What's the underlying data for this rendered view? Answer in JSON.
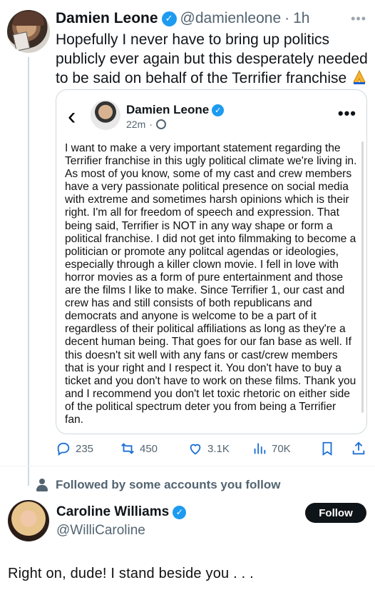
{
  "tweet": {
    "author_name": "Damien Leone",
    "handle": "@damienleone",
    "time": "1h",
    "text": "Hopefully I never have to bring up politics publicly ever again but this desperately needed to be said on behalf of the Terrifier franchise",
    "emoji": "folded-hands-icon"
  },
  "embedded": {
    "author_name": "Damien Leone",
    "time": "22m",
    "body": "I want to make a very important statement regarding the Terrifier franchise in this ugly political climate we're living in. As most of you know, some of my cast and crew members have a very passionate political presence on social media with extreme and sometimes harsh opinions which is their right. I'm all for freedom of speech and expression. That being said, Terrifier is NOT in any way shape or form a political franchise. I did not get into filmmaking to become a politician or promote any politcal agendas or ideologies, especially through a killer clown movie. I fell in love with horror movies as a form of pure entertainment and those are the films I like to make. Since Terrifier 1, our cast and crew has and still consists of both republicans and democrats and anyone is welcome to be a part of it regardless of their political affiliations as long as they're a decent human being. That goes for our fan base as well. If this doesn't sit well with any fans or cast/crew members that is your right and I respect it. You don't have to buy a ticket and you don't have to work on these films. Thank you and I recommend you don't let toxic rhetoric on either side of the political spectrum deter you from being a Terrifier fan."
  },
  "actions": {
    "replies": "235",
    "reposts": "450",
    "likes": "3.1K",
    "views": "70K"
  },
  "followed_by": "Followed by some accounts you follow",
  "suggested_user": {
    "name": "Caroline Williams",
    "handle": "@WilliCaroline",
    "button": "Follow"
  },
  "comment": "Right on, dude!  I stand beside you . . .",
  "colors": {
    "accent": "#1d9bf0",
    "secondary_text": "#536471",
    "border": "#cfd9de",
    "follow_button": "#0f1419"
  }
}
